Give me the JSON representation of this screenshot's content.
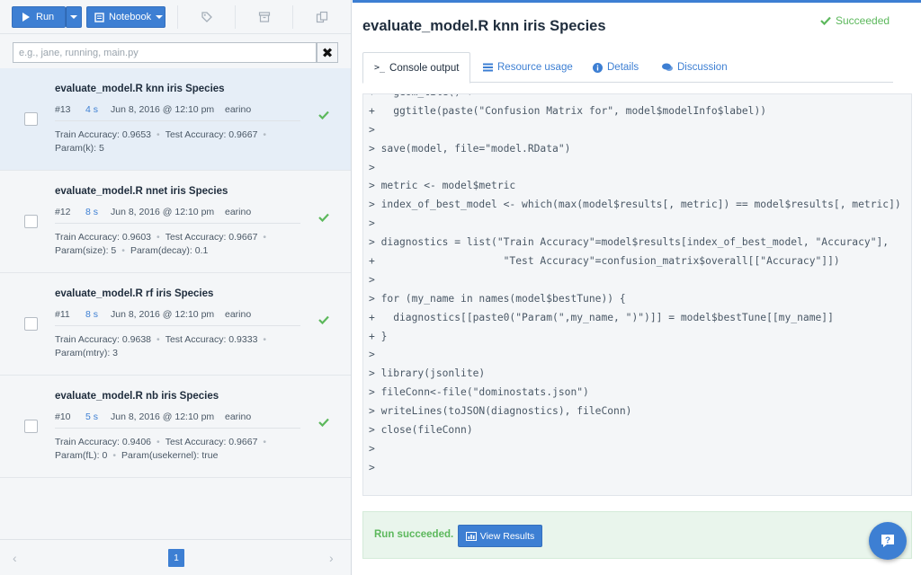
{
  "toolbar": {
    "run_label": "Run",
    "notebook_label": "Notebook",
    "icons": [
      "tag-icon",
      "archive-icon",
      "compare-icon"
    ]
  },
  "search": {
    "value": "",
    "placeholder": "e.g., jane, running, main.py"
  },
  "runs": [
    {
      "title": "evaluate_model.R knn iris Species",
      "number": "#13",
      "duration": "4 s",
      "date": "Jun 8, 2016 @ 12:10 pm",
      "user": "earino",
      "stats": [
        "Train Accuracy: 0.9653",
        "Test Accuracy: 0.9667",
        "Param(k): 5"
      ],
      "status": "succeeded",
      "selected": true
    },
    {
      "title": "evaluate_model.R nnet iris Species",
      "number": "#12",
      "duration": "8 s",
      "date": "Jun 8, 2016 @ 12:10 pm",
      "user": "earino",
      "stats": [
        "Train Accuracy: 0.9603",
        "Test Accuracy: 0.9667",
        "Param(size): 5",
        "Param(decay): 0.1"
      ],
      "status": "succeeded",
      "selected": false
    },
    {
      "title": "evaluate_model.R rf iris Species",
      "number": "#11",
      "duration": "8 s",
      "date": "Jun 8, 2016 @ 12:10 pm",
      "user": "earino",
      "stats": [
        "Train Accuracy: 0.9638",
        "Test Accuracy: 0.9333",
        "Param(mtry): 3"
      ],
      "status": "succeeded",
      "selected": false
    },
    {
      "title": "evaluate_model.R nb iris Species",
      "number": "#10",
      "duration": "5 s",
      "date": "Jun 8, 2016 @ 12:10 pm",
      "user": "earino",
      "stats": [
        "Train Accuracy: 0.9406",
        "Test Accuracy: 0.9667",
        "Param(fL): 0",
        "Param(usekernel): true"
      ],
      "status": "succeeded",
      "selected": false
    }
  ],
  "pagination": {
    "current_page": "1",
    "prev_label": "‹",
    "next_label": "›"
  },
  "detail": {
    "title": "evaluate_model.R knn iris Species",
    "status": "Succeeded",
    "tabs": [
      {
        "label": "Console output",
        "icon": "terminal-icon",
        "active": true
      },
      {
        "label": "Resource usage",
        "icon": "list-icon",
        "active": false
      },
      {
        "label": "Details",
        "icon": "info-icon",
        "active": false
      },
      {
        "label": "Discussion",
        "icon": "comments-icon",
        "active": false
      }
    ],
    "console_lines": [
      "+   geom_tile() +",
      "+   ggtitle(paste(\"Confusion Matrix for\", model$modelInfo$label))",
      ">",
      "> save(model, file=\"model.RData\")",
      ">",
      "> metric <- model$metric",
      "> index_of_best_model <- which(max(model$results[, metric]) == model$results[, metric])",
      ">",
      "> diagnostics = list(\"Train Accuracy\"=model$results[index_of_best_model, \"Accuracy\"],",
      "+                     \"Test Accuracy\"=confusion_matrix$overall[[\"Accuracy\"]])",
      ">",
      "> for (my_name in names(model$bestTune)) {",
      "+   diagnostics[[paste0(\"Param(\",my_name, \")\")]] = model$bestTune[[my_name]]",
      "+ }",
      ">",
      "> library(jsonlite)",
      "> fileConn<-file(\"dominostats.json\")",
      "> writeLines(toJSON(diagnostics), fileConn)",
      "> close(fileConn)",
      ">",
      ">"
    ],
    "success_message": "Run succeeded.",
    "view_results_label": "View Results"
  },
  "help_button": {
    "icon": "help-icon",
    "label": "?"
  },
  "colors": {
    "accent": "#3d7fd3",
    "success": "#5cb85c",
    "selected_row": "#e6eef7",
    "console_bg": "#f4f6f8"
  }
}
